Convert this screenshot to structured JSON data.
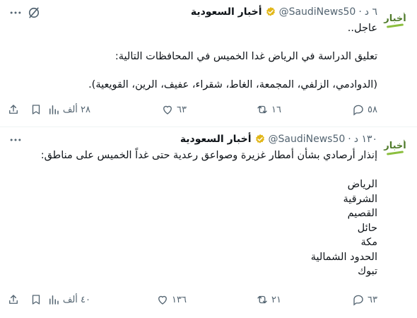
{
  "tweets": [
    {
      "display_name": "أخبار السعودية",
      "handle": "@SaudiNews50",
      "time": "٦ د",
      "avatar_text": "أخبار",
      "text": "عاجل..\n\nتعليق الدراسة في الرياض غدا الخميس في المحافظات التالية:\n\n(الدوادمي، الزلفي، المجمعة، الغاط، شقراء، عفيف، الرين، القويعية).",
      "replies": "٥٨",
      "reposts": "١٦",
      "likes": "٦٣",
      "views": "٢٨ ألف"
    },
    {
      "display_name": "أخبار السعودية",
      "handle": "@SaudiNews50",
      "time": "١٣٠ د",
      "avatar_text": "أخبار",
      "text": "إنذار أرصادي بشأن أمطار غزيرة وصواعق رعدية حتى غداً الخميس على مناطق:\n\nالرياض\nالشرقية\nالقصيم\nحائل\nمكة\nالحدود الشمالية\nتبوك",
      "replies": "٦٣",
      "reposts": "٢١",
      "likes": "١٣٦",
      "views": "٤٠ ألف"
    }
  ],
  "colors": {
    "text": "#0f1419",
    "secondary": "#536471",
    "verified": "#e2b719",
    "logo": "#4f7a2a",
    "divider": "#eff3f4"
  },
  "icons": [
    "more-icon",
    "grok-icon",
    "verified-badge-icon",
    "reply-icon",
    "repost-icon",
    "like-icon",
    "views-icon",
    "bookmark-icon",
    "share-icon"
  ]
}
